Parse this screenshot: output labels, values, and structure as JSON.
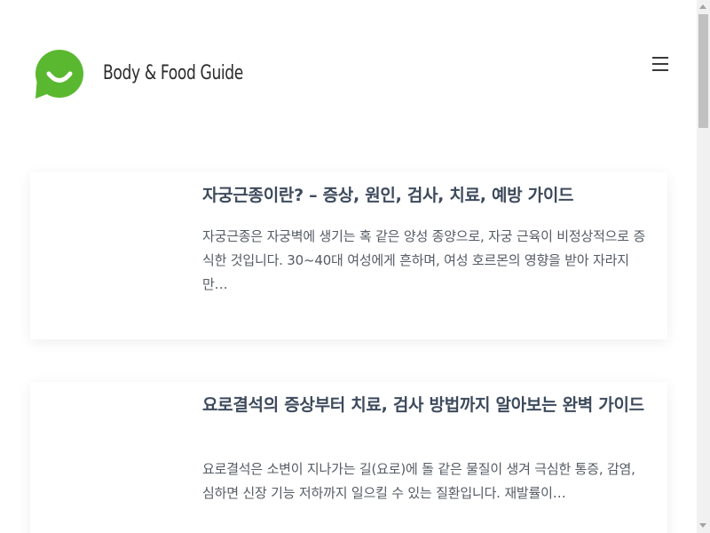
{
  "header": {
    "site_title": "Body & Food Guide",
    "logo_icon": "smiley-chat-bubble-icon",
    "menu_icon": "hamburger-menu-icon",
    "brand_color": "#5ab830"
  },
  "posts": [
    {
      "title": "자궁근종이란? – 증상, 원인, 검사, 치료, 예방 가이드",
      "excerpt": "자궁근종은 자궁벽에 생기는 혹 같은 양성 종양으로, 자궁 근육이 비정상적으로 증식한 것입니다. 30~40대 여성에게 흔하며, 여성 호르몬의 영향을 받아 자라지만…"
    },
    {
      "title": "요로결석의 증상부터 치료, 검사 방법까지 알아보는 완벽 가이드",
      "excerpt": "요로결석은 소변이 지나가는 길(요로)에 돌 같은 물질이 생겨 극심한 통증, 감염, 심하면 신장 기능 저하까지 일으킬 수 있는 질환입니다. 재발률이…"
    }
  ]
}
